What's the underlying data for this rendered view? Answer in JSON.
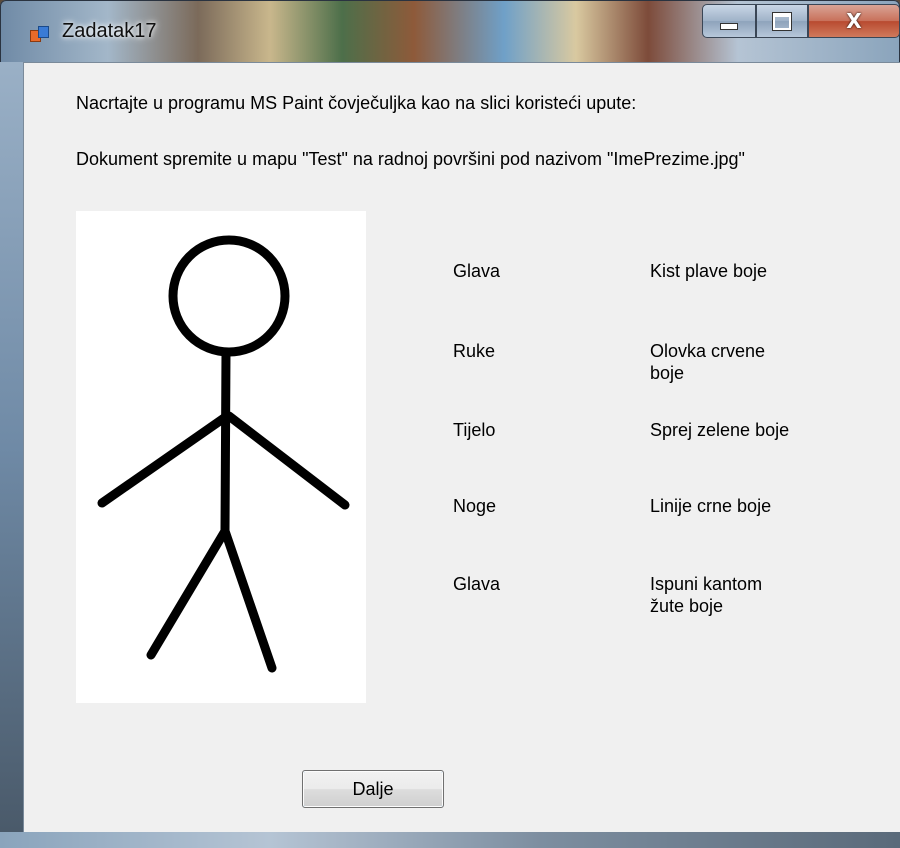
{
  "window": {
    "title": "Zadatak17",
    "minimize_glyph": "",
    "maximize_glyph": "",
    "close_glyph": "X"
  },
  "instructions": {
    "line1": "Nacrtajte u programu MS Paint čovječuljka kao na slici koristeći upute:",
    "line2": "Dokument spremite u mapu \"Test\" na radnoj površini pod nazivom \"ImePrezime.jpg\""
  },
  "steps": [
    {
      "part": "Glava",
      "tool": "Kist plave boje"
    },
    {
      "part": "Ruke",
      "tool": "Olovka crvene boje"
    },
    {
      "part": "Tijelo",
      "tool": "Sprej zelene boje"
    },
    {
      "part": "Noge",
      "tool": "Linije crne boje"
    },
    {
      "part": "Glava",
      "tool": "Ispuni kantom žute boje"
    }
  ],
  "buttons": {
    "next_label": "Dalje"
  },
  "colors": {
    "client_background": "#f0f0f0",
    "figure_background": "#ffffff",
    "figure_stroke": "#000000"
  }
}
